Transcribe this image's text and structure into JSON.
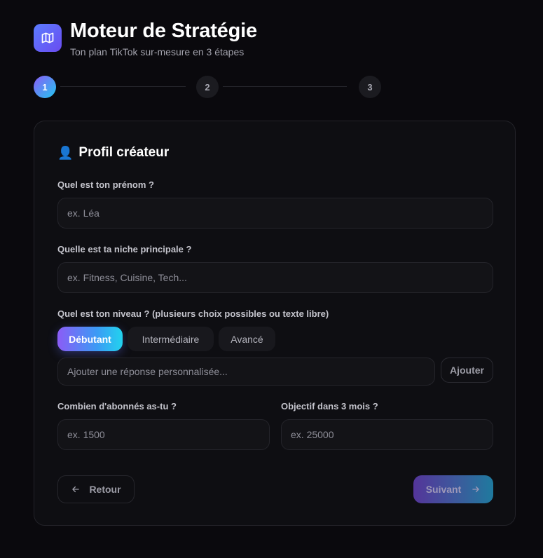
{
  "header": {
    "title": "Moteur de Stratégie",
    "subtitle": "Ton plan TikTok sur-mesure en 3 étapes",
    "logo_icon": "map-icon"
  },
  "stepper": {
    "steps": [
      {
        "label": "1",
        "state": "active"
      },
      {
        "label": "2",
        "state": "inactive"
      },
      {
        "label": "3",
        "state": "inactive"
      }
    ]
  },
  "form": {
    "section_title": "Profil créateur",
    "section_icon": "👤",
    "first_name": {
      "label": "Quel est ton prénom ?",
      "placeholder": "ex. Léa",
      "value": ""
    },
    "niche": {
      "label": "Quelle est ta niche principale ?",
      "placeholder": "ex. Fitness, Cuisine, Tech...",
      "value": ""
    },
    "level": {
      "label": "Quel est ton niveau ? (plusieurs choix possibles ou texte libre)",
      "options": [
        {
          "label": "Débutant",
          "selected": true
        },
        {
          "label": "Intermédiaire",
          "selected": false
        },
        {
          "label": "Avancé",
          "selected": false
        }
      ],
      "custom_placeholder": "Ajouter une réponse personnalisée...",
      "add_label": "Ajouter"
    },
    "followers": {
      "label": "Combien d'abonnés as-tu ?",
      "placeholder": "ex. 1500",
      "value": ""
    },
    "goal": {
      "label": "Objectif dans 3 mois ?",
      "placeholder": "ex. 25000",
      "value": ""
    }
  },
  "nav": {
    "back_label": "Retour",
    "next_label": "Suivant"
  },
  "colors": {
    "background": "#0a090d",
    "accent_start": "#8b5cf6",
    "accent_end": "#22d3ee",
    "logo": "#5b6cf8"
  }
}
